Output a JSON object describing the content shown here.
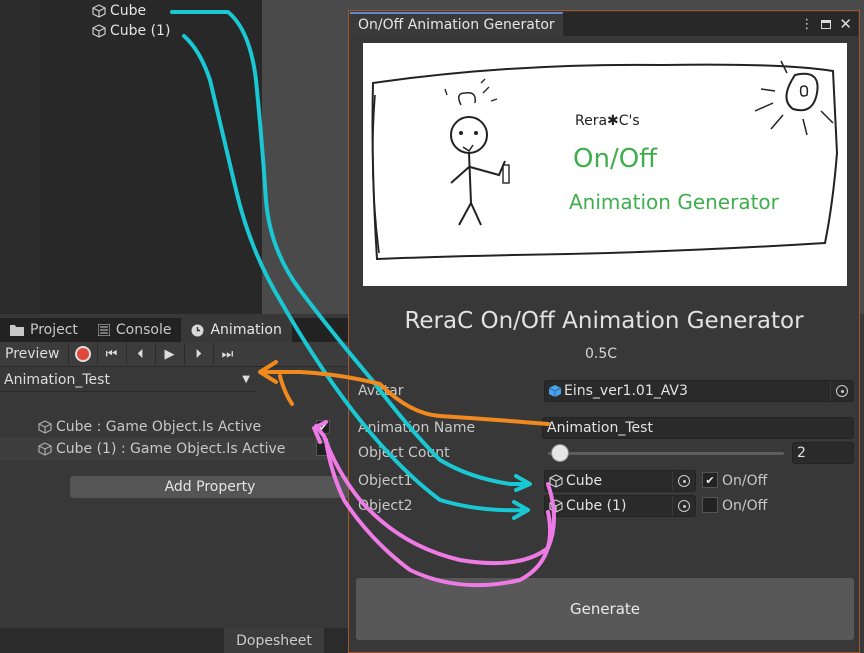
{
  "hierarchy": {
    "items": [
      {
        "label": "Cube"
      },
      {
        "label": "Cube (1)"
      }
    ]
  },
  "bottom_panel": {
    "tabs": [
      {
        "label": "Project",
        "icon": "folder-icon"
      },
      {
        "label": "Console",
        "icon": "console-icon"
      },
      {
        "label": "Animation",
        "icon": "clock-icon"
      }
    ],
    "preview_label": "Preview",
    "clip_name": "Animation_Test",
    "properties": [
      {
        "label": "Cube : Game Object.Is Active",
        "checked": true
      },
      {
        "label": "Cube (1) : Game Object.Is Active",
        "checked": false
      }
    ],
    "add_property_label": "Add Property",
    "dopesheet_label": "Dopesheet"
  },
  "window": {
    "title": "On/Off Animation Generator",
    "banner": {
      "author": "Rera✱C's",
      "line1": "On/Off",
      "line2": "Animation Generator"
    },
    "app_title": "ReraC On/Off Animation Generator",
    "version": "0.5C",
    "fields": {
      "avatar_label": "Avatar",
      "avatar_value": "Eins_ver1.01_AV3",
      "anim_name_label": "Animation Name",
      "anim_name_value": "Animation_Test",
      "object_count_label": "Object Count",
      "object_count_value": "2",
      "object_count_fraction": 0.05,
      "objects": [
        {
          "label": "Object1",
          "value": "Cube",
          "toggle_label": "On/Off",
          "checked": true
        },
        {
          "label": "Object2",
          "value": "Cube (1)",
          "toggle_label": "On/Off",
          "checked": false
        }
      ]
    },
    "generate_label": "Generate"
  },
  "colors": {
    "cyan_annotation": "#19c8d2",
    "orange_annotation": "#f08a1e",
    "magenta_annotation": "#ee7ae6",
    "window_border": "#a0562c",
    "banner_green": "#3fae4e"
  }
}
